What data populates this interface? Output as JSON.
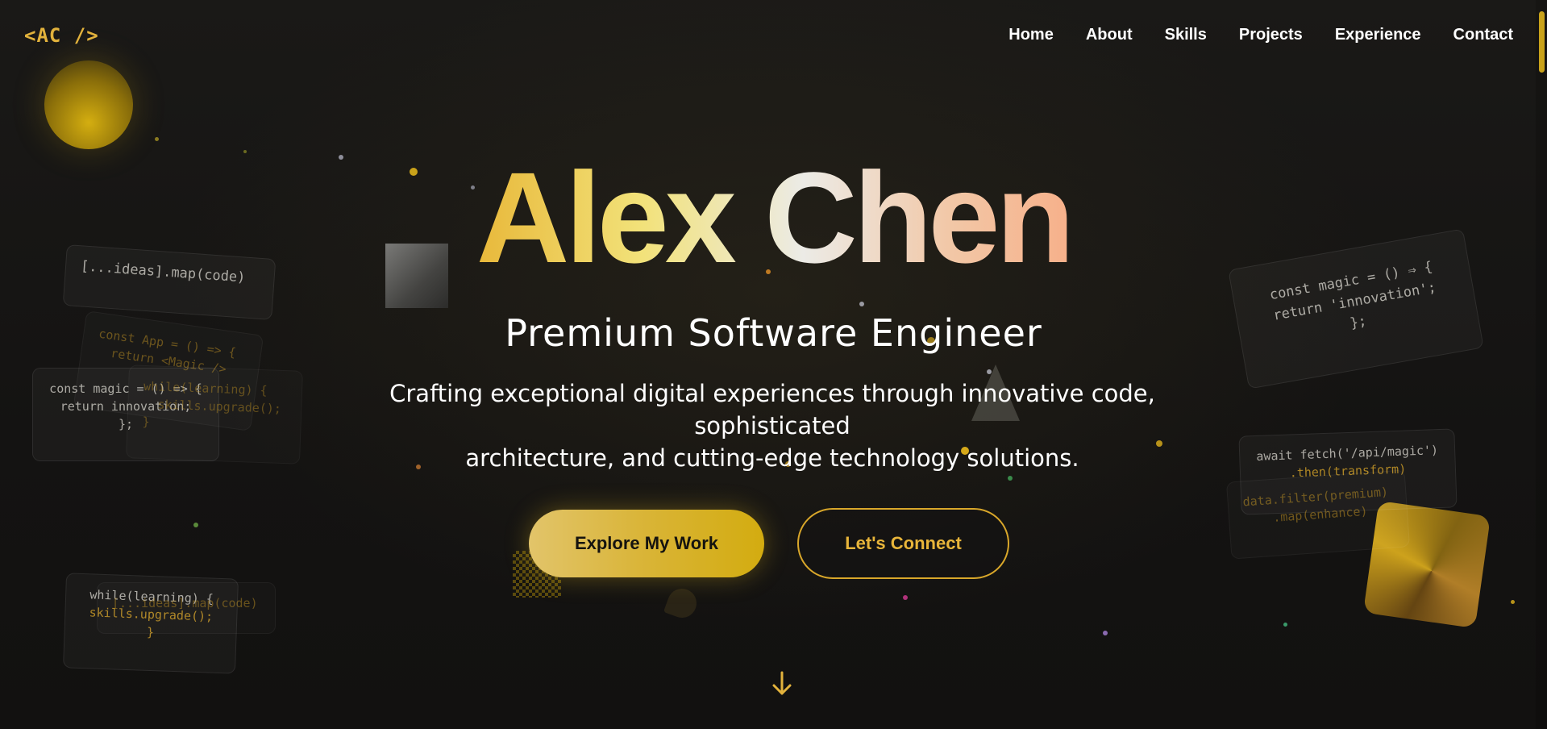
{
  "logo": {
    "text": "<AC />"
  },
  "nav": {
    "items": [
      {
        "label": "Home"
      },
      {
        "label": "About"
      },
      {
        "label": "Skills"
      },
      {
        "label": "Projects"
      },
      {
        "label": "Experience"
      },
      {
        "label": "Contact"
      }
    ]
  },
  "hero": {
    "name": "Alex Chen",
    "subtitle": "Premium Software Engineer",
    "description_line1": "Crafting exceptional digital experiences through innovative code, sophisticated",
    "description_line2": "architecture, and cutting-edge technology solutions.",
    "primary_button": "Explore My Work",
    "secondary_button": "Let's Connect",
    "scroll_icon": "arrow-down-icon"
  },
  "code_cards": {
    "ideas_map": "[...ideas].map(code)",
    "const_app_l1": "const App = () => {",
    "const_app_l2": "return <Magic />",
    "magic_l1": "const magic = () => {",
    "magic_l2": "return innovation;",
    "magic_l3": "};",
    "learning_l1": "while(learning) {",
    "learning_l2": "skills.upgrade();",
    "learning_l3": "}",
    "ideas_map_2": "[...ideas].map(code)",
    "right_magic_l1": "const magic = () ⇒ {",
    "right_magic_l2": "return 'innovation';",
    "right_magic_l3": "};",
    "fetch_l1": "await fetch('/api/magic')",
    "fetch_l2": ".then(transform)",
    "filter_l1": "data.filter(premium)",
    "filter_l2": ".map(enhance)"
  },
  "colors": {
    "accent": "#e2b23c",
    "background": "#141312",
    "text": "#ffffff"
  }
}
